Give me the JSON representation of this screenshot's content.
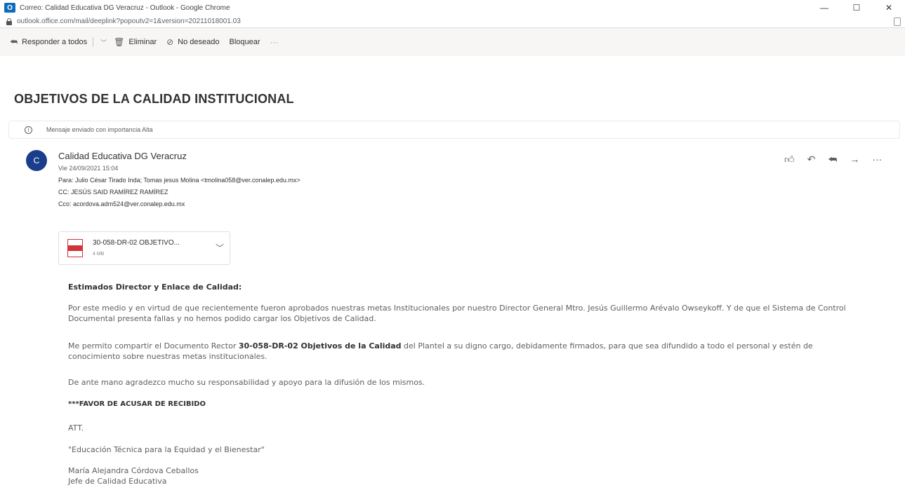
{
  "window": {
    "title": "Correo: Calidad Educativa DG Veracruz - Outlook - Google Chrome",
    "minimize": "—",
    "maximize": "☐",
    "close": "✕"
  },
  "address": {
    "url": "outlook.office.com/mail/deeplink?popoutv2=1&version=20211018001.03"
  },
  "toolbar": {
    "reply_all": "Responder a todos",
    "delete": "Eliminar",
    "junk": "No deseado",
    "block": "Bloquear"
  },
  "message": {
    "subject": "OBJETIVOS DE LA CALIDAD INSTITUCIONAL",
    "importance": "Mensaje enviado con importancia Alta",
    "avatar_initial": "C",
    "sender": "Calidad Educativa DG Veracruz",
    "date": "Vie 24/09/2021 15:04",
    "to_label": "Para:",
    "to": "Julio César Tirado Inda; Tomas jesus Molina <tmolina058@ver.conalep.edu.mx>",
    "cc_label": "CC:",
    "cc": "JESÚS SAID RAMÍREZ RAMÍREZ",
    "bcc_label": "Cco:",
    "bcc": "acordova.adm524@ver.conalep.edu.mx"
  },
  "attachment": {
    "name": "30-058-DR-02 OBJETIVO...",
    "size": "4 MB"
  },
  "body": {
    "greeting": "Estimados Director y Enlace de Calidad:",
    "p1": "Por este medio y en virtud de que recientemente fueron aprobados nuestras metas Institucionales por nuestro Director General Mtro. Jesús Guillermo Arévalo Owseykoff. Y de que el Sistema de Control Documental presenta fallas y no hemos podido cargar los Objetivos de Calidad.",
    "p2_a": "Me permito compartir el Documento Rector ",
    "p2_b": "30-058-DR-02 Objetivos de la Calidad",
    "p2_c": " del Plantel a su digno cargo, debidamente firmados, para que sea difundido a todo el personal y estén de conocimiento sobre nuestras metas institucionales.",
    "p3": "De ante mano agradezco mucho su responsabilidad y apoyo para la difusión de los mismos.",
    "p4": "***FAVOR DE ACUSAR DE RECIBIDO",
    "p5": "ATT.",
    "p6": "\"Educación Técnica para la Equidad y el Bienestar\"",
    "p7": "María Alejandra Córdova Ceballos",
    "p8": "Jefe de Calidad Educativa"
  }
}
